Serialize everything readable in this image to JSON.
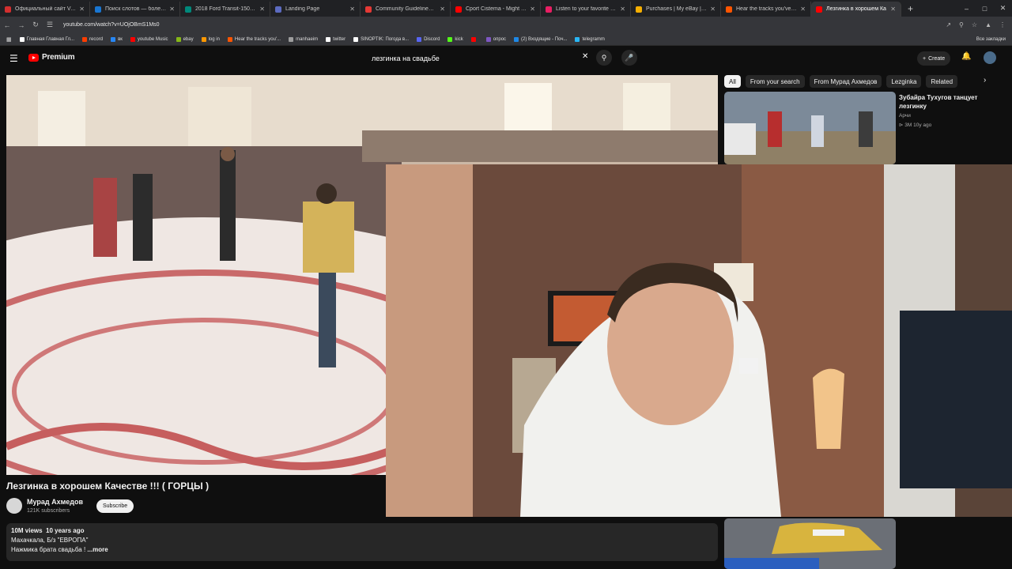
{
  "browser": {
    "tabs": [
      {
        "label": "Официальный сайт VAVADA",
        "color": "#d32f2f"
      },
      {
        "label": "Поиск слотов — более 5000",
        "color": "#1976d2"
      },
      {
        "label": "2018 Ford Transit-150 Base w",
        "color": "#00897b"
      },
      {
        "label": "Landing Page",
        "color": "#5c6bc0"
      },
      {
        "label": "Community Guidelines Violati",
        "color": "#e53935"
      },
      {
        "label": "Cport Cistema - Might Try - Y",
        "color": "#ff0000"
      },
      {
        "label": "Listen to your favorite songs",
        "color": "#e91e63"
      },
      {
        "label": "Purchases | My eBay | eBay",
        "color": "#f5af02"
      },
      {
        "label": "Hear the tracks you've liked",
        "color": "#ff5500"
      },
      {
        "label": "Лезгинка в хорошем Ка",
        "color": "#ff0000"
      }
    ],
    "active_tab": 9,
    "url": "youtube.com/watch?v=UOjOBmS1Ms0",
    "bookmarks": [
      {
        "label": "Главная Главная Гл...",
        "color": "#ffffff"
      },
      {
        "label": "record",
        "color": "#ff3d00"
      },
      {
        "label": "вк",
        "color": "#2787f5"
      },
      {
        "label": "youtube Music",
        "color": "#ff0000"
      },
      {
        "label": "ebay",
        "color": "#86b817"
      },
      {
        "label": "log in",
        "color": "#ff9800"
      },
      {
        "label": "Hear the tracks you'...",
        "color": "#ff5500"
      },
      {
        "label": "manhaeim",
        "color": "#9e9e9e"
      },
      {
        "label": "twitter",
        "color": "#ffffff"
      },
      {
        "label": "SINOPTIK: Погода в...",
        "color": "#ffffff"
      },
      {
        "label": "Discord",
        "color": "#5865f2"
      },
      {
        "label": "kick",
        "color": "#53fc18"
      },
      {
        "label": "",
        "color": "#ff0000"
      },
      {
        "label": "опрос",
        "color": "#7e57c2"
      },
      {
        "label": "(2) Входящие - Поч...",
        "color": "#1e88e5"
      },
      {
        "label": "telegramm",
        "color": "#29b6f6"
      }
    ],
    "bookmarks_all": "Все закладки"
  },
  "youtube": {
    "logo": "Premium",
    "search_query": "лезгинка на свадьбе",
    "create_label": "Create",
    "chips": [
      "All",
      "From your search",
      "From Мурад Ахмедов",
      "Lezginka",
      "Related"
    ],
    "related": [
      {
        "title": "Зубайра Тухугов танцует лезгинку",
        "channel": "Арчи",
        "views": "3M",
        "age": "10y ago"
      }
    ],
    "video": {
      "title": "Лезгинка в хорошем Качестве !!! ( ГОРЦЫ )",
      "channel": "Мурад Ахмедов",
      "subscribers": "121K subscribers",
      "subscribe": "Subscribe",
      "views": "10M views",
      "age": "10 years ago",
      "desc_line1": "Махачкала, Б/з \"ЕВРОПА\"",
      "desc_line2": "Нажмика брата свадьба ! ",
      "more": "...more"
    }
  }
}
